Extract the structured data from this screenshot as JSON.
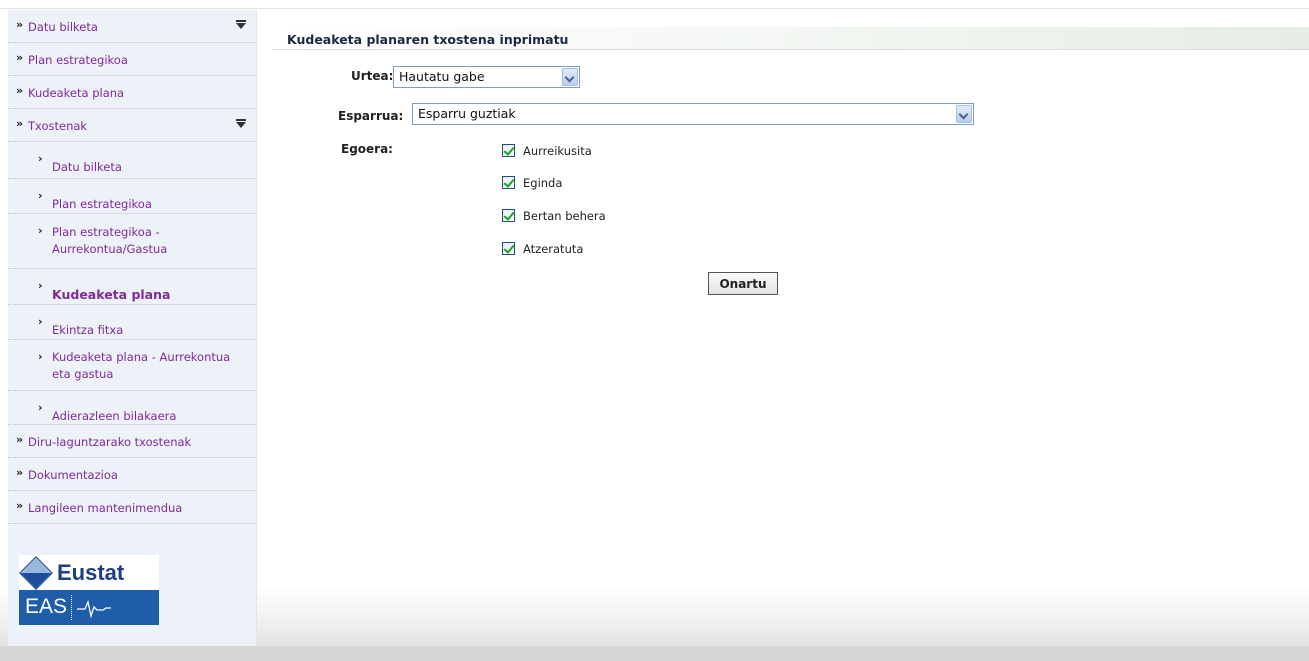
{
  "sidebar": {
    "items": [
      {
        "label": "Datu bilketa",
        "expanded": true
      },
      {
        "label": "Plan estrategikoa"
      },
      {
        "label": "Kudeaketa plana"
      },
      {
        "label": "Txostenak",
        "expanded": true
      },
      {
        "label": "Diru-laguntzarako txostenak"
      },
      {
        "label": "Dokumentazioa"
      },
      {
        "label": "Langileen mantenimendua"
      }
    ],
    "subitems": [
      {
        "label": "Datu bilketa"
      },
      {
        "label": "Plan estrategikoa"
      },
      {
        "label": "Plan estrategikoa - Aurrekontua/Gastua"
      },
      {
        "label": "Kudeaketa plana",
        "active": true
      },
      {
        "label": "Ekintza fitxa"
      },
      {
        "label": "Kudeaketa plana - Aurrekontua eta gastua"
      },
      {
        "label": "Adierazleen bilakaera"
      }
    ],
    "bullet": "»",
    "sub_bullet": "›",
    "logo": {
      "eustat": "Eustat",
      "eas": "EAS"
    }
  },
  "main": {
    "title": "Kudeaketa planaren txostena inprimatu",
    "urtea": {
      "label": "Urtea:",
      "value": "Hautatu gabe"
    },
    "esparrua": {
      "label": "Esparrua:",
      "value": "Esparru guztiak"
    },
    "egoera": {
      "label": "Egoera:",
      "options": [
        {
          "label": "Aurreikusita",
          "checked": true
        },
        {
          "label": "Eginda",
          "checked": true
        },
        {
          "label": "Bertan behera",
          "checked": true
        },
        {
          "label": "Atzeratuta",
          "checked": true
        }
      ]
    },
    "submit_label": "Onartu"
  },
  "colors": {
    "menu_text": "#7f2a9b",
    "sidebar_bg": "#edf2f8",
    "logo_blue": "#1f5da8"
  }
}
